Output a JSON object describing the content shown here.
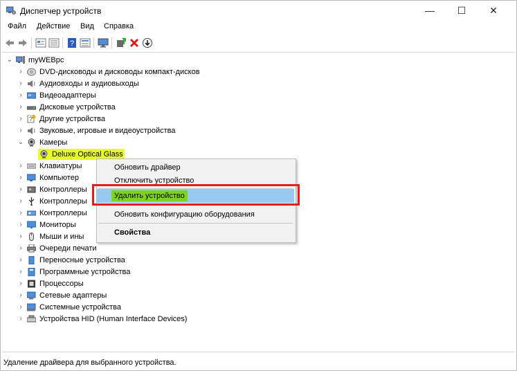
{
  "window": {
    "title": "Диспетчер устройств",
    "controls": {
      "minimize": "—",
      "maximize": "☐",
      "close": "✕"
    }
  },
  "menu": [
    "Файл",
    "Действие",
    "Вид",
    "Справка"
  ],
  "toolbar_icons": [
    "back-arrow-icon",
    "forward-arrow-icon",
    "properties-icon",
    "properties-view-icon",
    "help-icon",
    "details-icon",
    "monitor-icon",
    "add-driver-icon",
    "remove-icon",
    "download-icon"
  ],
  "colors": {
    "highlight": "#e8ff2a",
    "selection": "#99c8f0",
    "red_box": "#e81c1c",
    "remove_icon": "#d61a1a"
  },
  "tree": {
    "root": "myWEBpc",
    "categories": [
      "DVD-дисководы и дисководы компакт-дисков",
      "Аудиовходы и аудиовыходы",
      "Видеоадаптеры",
      "Дисковые устройства",
      "Другие устройства",
      "Звуковые, игровые и видеоустройства",
      "Камеры"
    ],
    "camera_child": "Deluxe Optical Glass",
    "categories_after": [
      "Клавиатуры",
      "Компьютер",
      "Контроллеры",
      "Контроллеры",
      "Контроллеры",
      "Мониторы",
      "Мыши и ины",
      "Очереди печати",
      "Переносные устройства",
      "Программные устройства",
      "Процессоры",
      "Сетевые адаптеры",
      "Системные устройства",
      "Устройства HID (Human Interface Devices)"
    ]
  },
  "context_menu": {
    "items": [
      "Обновить драйвер",
      "Отключить устройство",
      "Удалить устройство",
      "Обновить конфигурацию оборудования",
      "Свойства"
    ],
    "selected_index": 2
  },
  "status_bar": "Удаление драйвера для выбранного устройства."
}
